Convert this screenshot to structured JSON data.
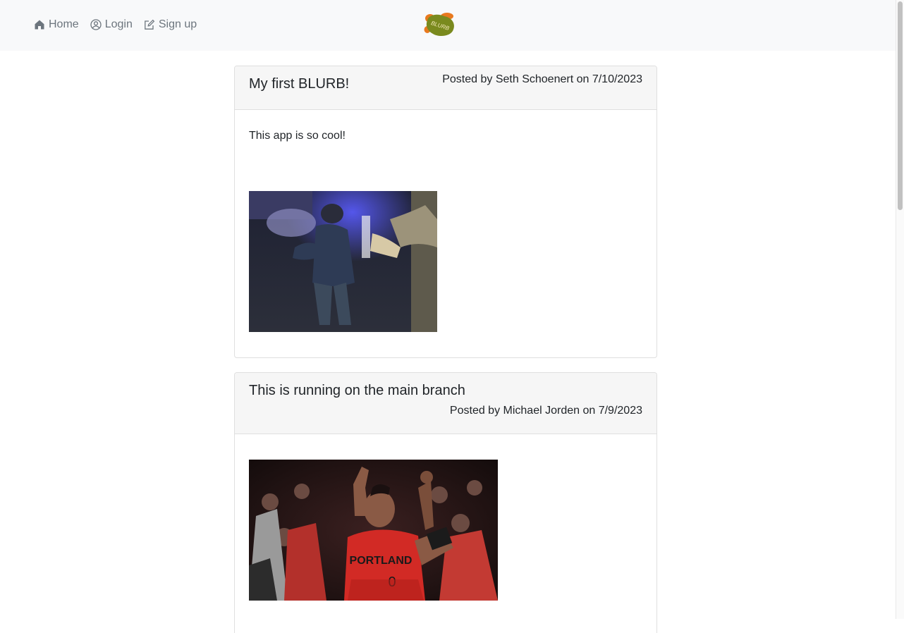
{
  "nav": {
    "home_label": "Home",
    "login_label": "Login",
    "signup_label": "Sign up",
    "icons": [
      "home-icon",
      "user-circle-icon",
      "pencil-square-icon"
    ],
    "logo_text": "BLURB"
  },
  "posts": [
    {
      "title": "My first BLURB!",
      "meta": "Posted by Seth Schoenert on 7/10/2023",
      "body": "This app is so cool!",
      "image_alt": "kid dancing gif"
    },
    {
      "title": "This is running on the main branch",
      "meta": "Posted by Michael Jorden on 7/9/2023",
      "body": "",
      "image_alt": "Portland basketball player celebrating gif"
    }
  ],
  "colors": {
    "navbar_bg": "#f8f9fa",
    "nav_text": "#6c757d",
    "card_header_bg": "#f6f6f6",
    "logo_olive": "#7a8a1e",
    "logo_orange": "#e8791e",
    "jersey_red": "#d22a25"
  }
}
